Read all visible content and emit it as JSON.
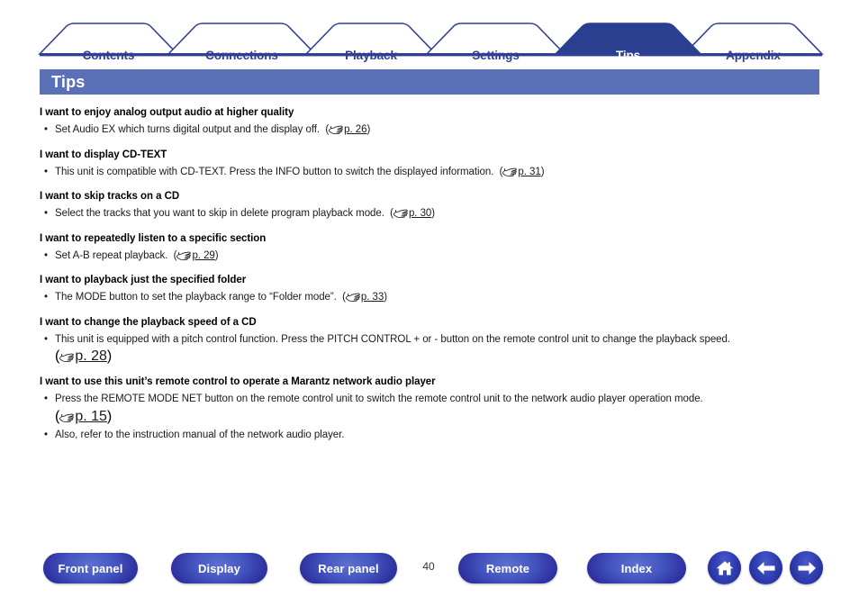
{
  "tabs": [
    {
      "label": "Contents",
      "active": false
    },
    {
      "label": "Connections",
      "active": false
    },
    {
      "label": "Playback",
      "active": false
    },
    {
      "label": "Settings",
      "active": false
    },
    {
      "label": "Tips",
      "active": true
    },
    {
      "label": "Appendix",
      "active": false
    }
  ],
  "page_title": "Tips",
  "sections": [
    {
      "heading": "I want to enjoy analog output audio at higher quality",
      "items": [
        {
          "text": "Set Audio EX which turns digital output and the display off.",
          "ref": "p. 26"
        }
      ]
    },
    {
      "heading": "I want to display CD-TEXT",
      "items": [
        {
          "text": "This unit is compatible with CD-TEXT. Press the INFO button to switch the displayed information.",
          "ref": "p. 31"
        }
      ]
    },
    {
      "heading": "I want to skip tracks on a CD",
      "items": [
        {
          "text": "Select the tracks that you want to skip in delete program playback mode.",
          "ref": "p. 30"
        }
      ]
    },
    {
      "heading": "I want to repeatedly listen to a specific section",
      "items": [
        {
          "text": "Set A-B repeat playback.",
          "ref": "p. 29"
        }
      ]
    },
    {
      "heading": "I want to playback just the specified folder",
      "items": [
        {
          "text": "The MODE button to set the playback range to “Folder mode”.",
          "ref": "p. 33"
        }
      ]
    },
    {
      "heading": "I want to change the playback speed of a CD",
      "items": [
        {
          "text": "This unit is equipped with a pitch control function. Press the PITCH CONTROL + or - button on the remote control unit to change the playback speed.",
          "ref": "p. 28",
          "ref_on_newline": true
        }
      ]
    },
    {
      "heading": "I want to use this unit’s remote control to operate a Marantz network audio player",
      "items": [
        {
          "text": "Press the REMOTE MODE NET button on the remote control unit to switch the remote control unit to the network audio player operation mode.",
          "ref": "p. 15",
          "ref_on_newline": true
        },
        {
          "text": "Also, refer to the instruction manual of the network audio player.",
          "ref": null
        }
      ]
    }
  ],
  "footer": {
    "buttons": [
      {
        "label": "Front panel"
      },
      {
        "label": "Display"
      },
      {
        "label": "Rear panel"
      },
      {
        "label": "Remote"
      },
      {
        "label": "Index"
      }
    ],
    "page_number": "40",
    "icon_buttons": [
      {
        "icon": "home-icon"
      },
      {
        "icon": "arrow-left-icon"
      },
      {
        "icon": "arrow-right-icon"
      }
    ]
  },
  "colors": {
    "tab_border": "#2f3f93",
    "tab_active_fill": "#2a3f8f",
    "titlebar": "#5a71b8",
    "rule": "#2f3f93"
  }
}
